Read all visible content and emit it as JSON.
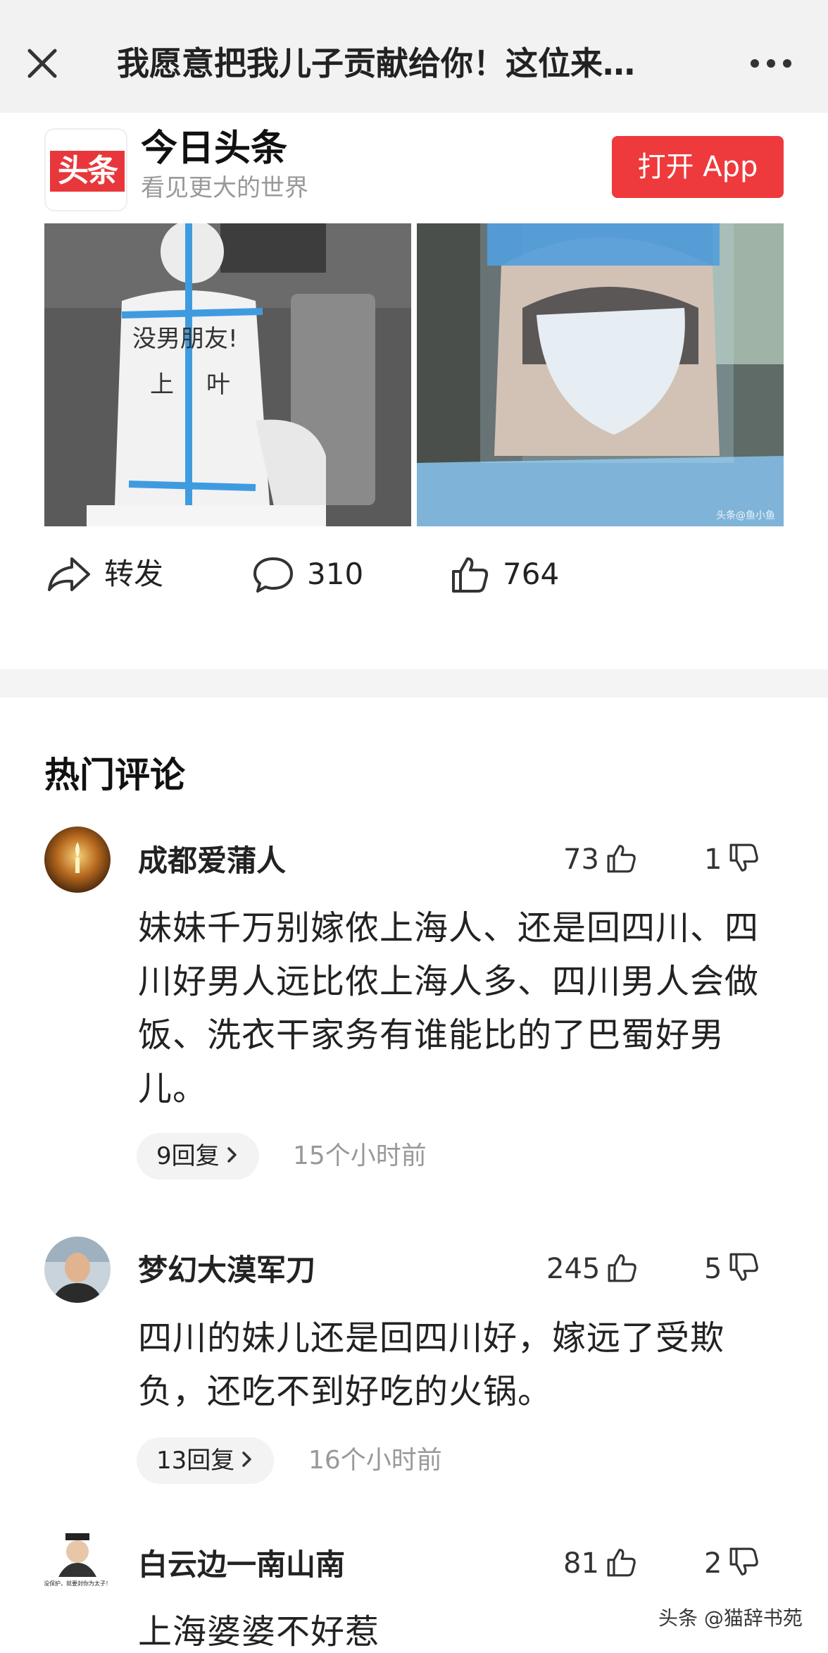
{
  "nav": {
    "title": "我愿意把我儿子贡献给你！这位来…"
  },
  "app": {
    "logo_text": "头条",
    "name": "今日头条",
    "slogan": "看见更大的世界",
    "open_button": "打开 App"
  },
  "photos": {
    "left_suit_text": "没男朋友!",
    "right_watermark": "头条@鱼小鱼"
  },
  "actions": {
    "share_label": "转发",
    "comment_count": "310",
    "like_count": "764"
  },
  "comments_section": {
    "title": "热门评论",
    "items": [
      {
        "name": "成都爱蒲人",
        "likes": "73",
        "dislikes": "1",
        "text": "妹妹千万别嫁侬上海人、还是回四川、四川好男人远比侬上海人多、四川男人会做饭、洗衣干家务有谁能比的了巴蜀好男儿。",
        "replies": "9回复",
        "time": "15个小时前"
      },
      {
        "name": "梦幻大漠军刀",
        "likes": "245",
        "dislikes": "5",
        "text": "四川的妹儿还是回四川好，嫁远了受欺负，还吃不到好吃的火锅。",
        "replies": "13回复",
        "time": "16个小时前"
      },
      {
        "name": "白云边一南山南",
        "likes": "81",
        "dislikes": "2",
        "text": "上海婆婆不好惹",
        "avatar_caption": "没保护，就要封你为太子！"
      }
    ]
  },
  "footer": {
    "watermark": "头条 @猫辞书苑"
  },
  "colors": {
    "accent_red": "#ee3a3d",
    "nav_bg": "#f2f2f2",
    "muted_text": "#999999"
  },
  "icons": [
    "close-icon",
    "more-icon",
    "share-icon",
    "comment-icon",
    "thumbs-up-icon",
    "thumbs-down-icon",
    "chevron-right-icon"
  ]
}
